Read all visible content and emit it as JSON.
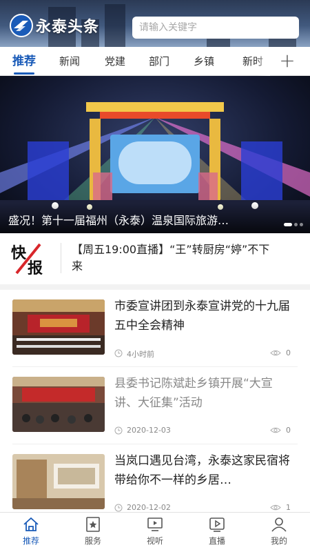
{
  "header": {
    "app_name": "永泰头条",
    "search_placeholder": "请输入关键字"
  },
  "tabs": [
    {
      "label": "推荐",
      "active": true
    },
    {
      "label": "新闻",
      "active": false
    },
    {
      "label": "党建",
      "active": false
    },
    {
      "label": "部门",
      "active": false
    },
    {
      "label": "乡镇",
      "active": false
    },
    {
      "label": "新时",
      "active": false
    }
  ],
  "tab_more_icon": "plus-icon",
  "banner": {
    "title": "盛况！第十一届福州（永泰）温泉国际旅游…",
    "dot_count": 3,
    "active_dot": 0
  },
  "flash": {
    "logo_chars": [
      "快",
      "报"
    ],
    "text": "【周五19:00直播】“王”转厨房“婷”不下来"
  },
  "news": [
    {
      "title": "市委宣讲团到永泰宣讲党的十九届五中全会精神",
      "time": "4小时前",
      "views": "0",
      "visited": false
    },
    {
      "title": "县委书记陈斌赴乡镇开展“大宣讲、大征集”活动",
      "time": "2020-12-03",
      "views": "0",
      "visited": true
    },
    {
      "title": "当岚口遇见台湾，永泰这家民宿将带给你不一样的乡居…",
      "time": "2020-12-02",
      "views": "1",
      "visited": false
    }
  ],
  "bottom_nav": [
    {
      "label": "推荐",
      "icon": "home-icon",
      "active": true
    },
    {
      "label": "服务",
      "icon": "star-square-icon",
      "active": false
    },
    {
      "label": "视听",
      "icon": "tv-icon",
      "active": false
    },
    {
      "label": "直播",
      "icon": "play-screen-icon",
      "active": false
    },
    {
      "label": "我的",
      "icon": "user-icon",
      "active": false
    }
  ],
  "colors": {
    "accent": "#1a5bb8",
    "flash_red": "#d8262b"
  }
}
